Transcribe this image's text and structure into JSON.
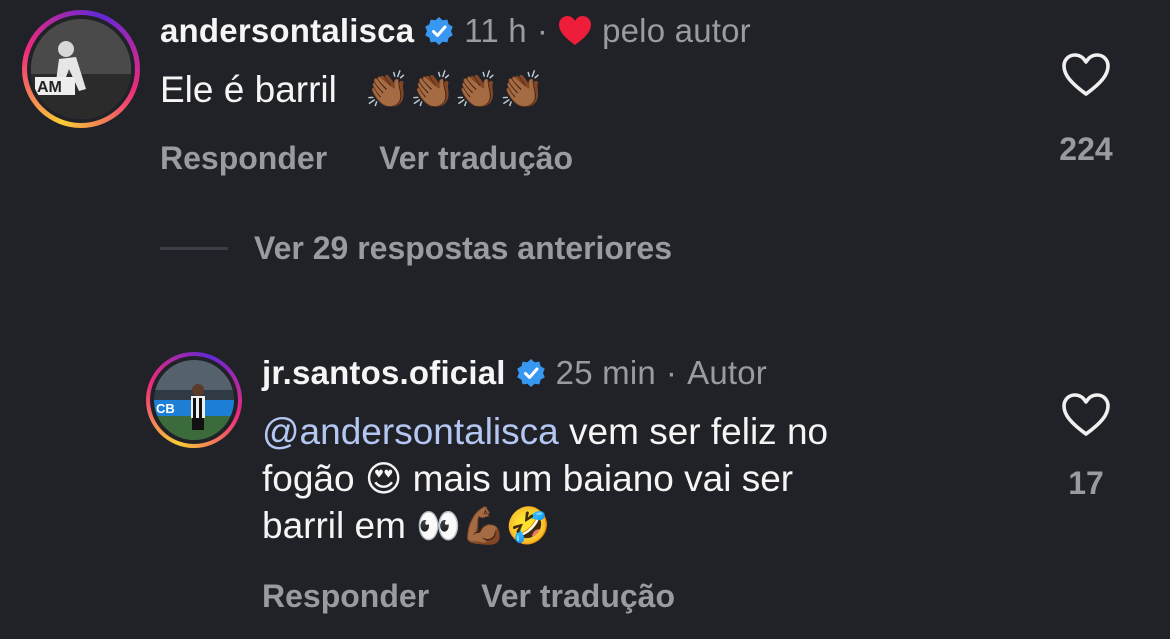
{
  "comment1": {
    "username": "andersontalisca",
    "time": "11 h",
    "separator": "·",
    "liked_by_author": "pelo autor",
    "text": "Ele é barril",
    "emojis": "👏🏾👏🏾👏🏾👏🏾",
    "reply_label": "Responder",
    "translate_label": "Ver tradução",
    "likes": "224"
  },
  "view_replies": "Ver 29 respostas anteriores",
  "comment2": {
    "username": "jr.santos.oficial",
    "time": "25 min",
    "separator": "·",
    "author_label": "Autor",
    "mention": "@andersontalisca",
    "text_line1_rest": " vem ser feliz no",
    "text_line2_a": "fogão ",
    "emoji_heart_eyes": "😍",
    "text_line2_b": " mais um baiano vai ser",
    "text_line3": "barril em ",
    "emojis_line3": "👀💪🏾🤣",
    "reply_label": "Responder",
    "translate_label": "Ver tradução",
    "likes": "17"
  }
}
